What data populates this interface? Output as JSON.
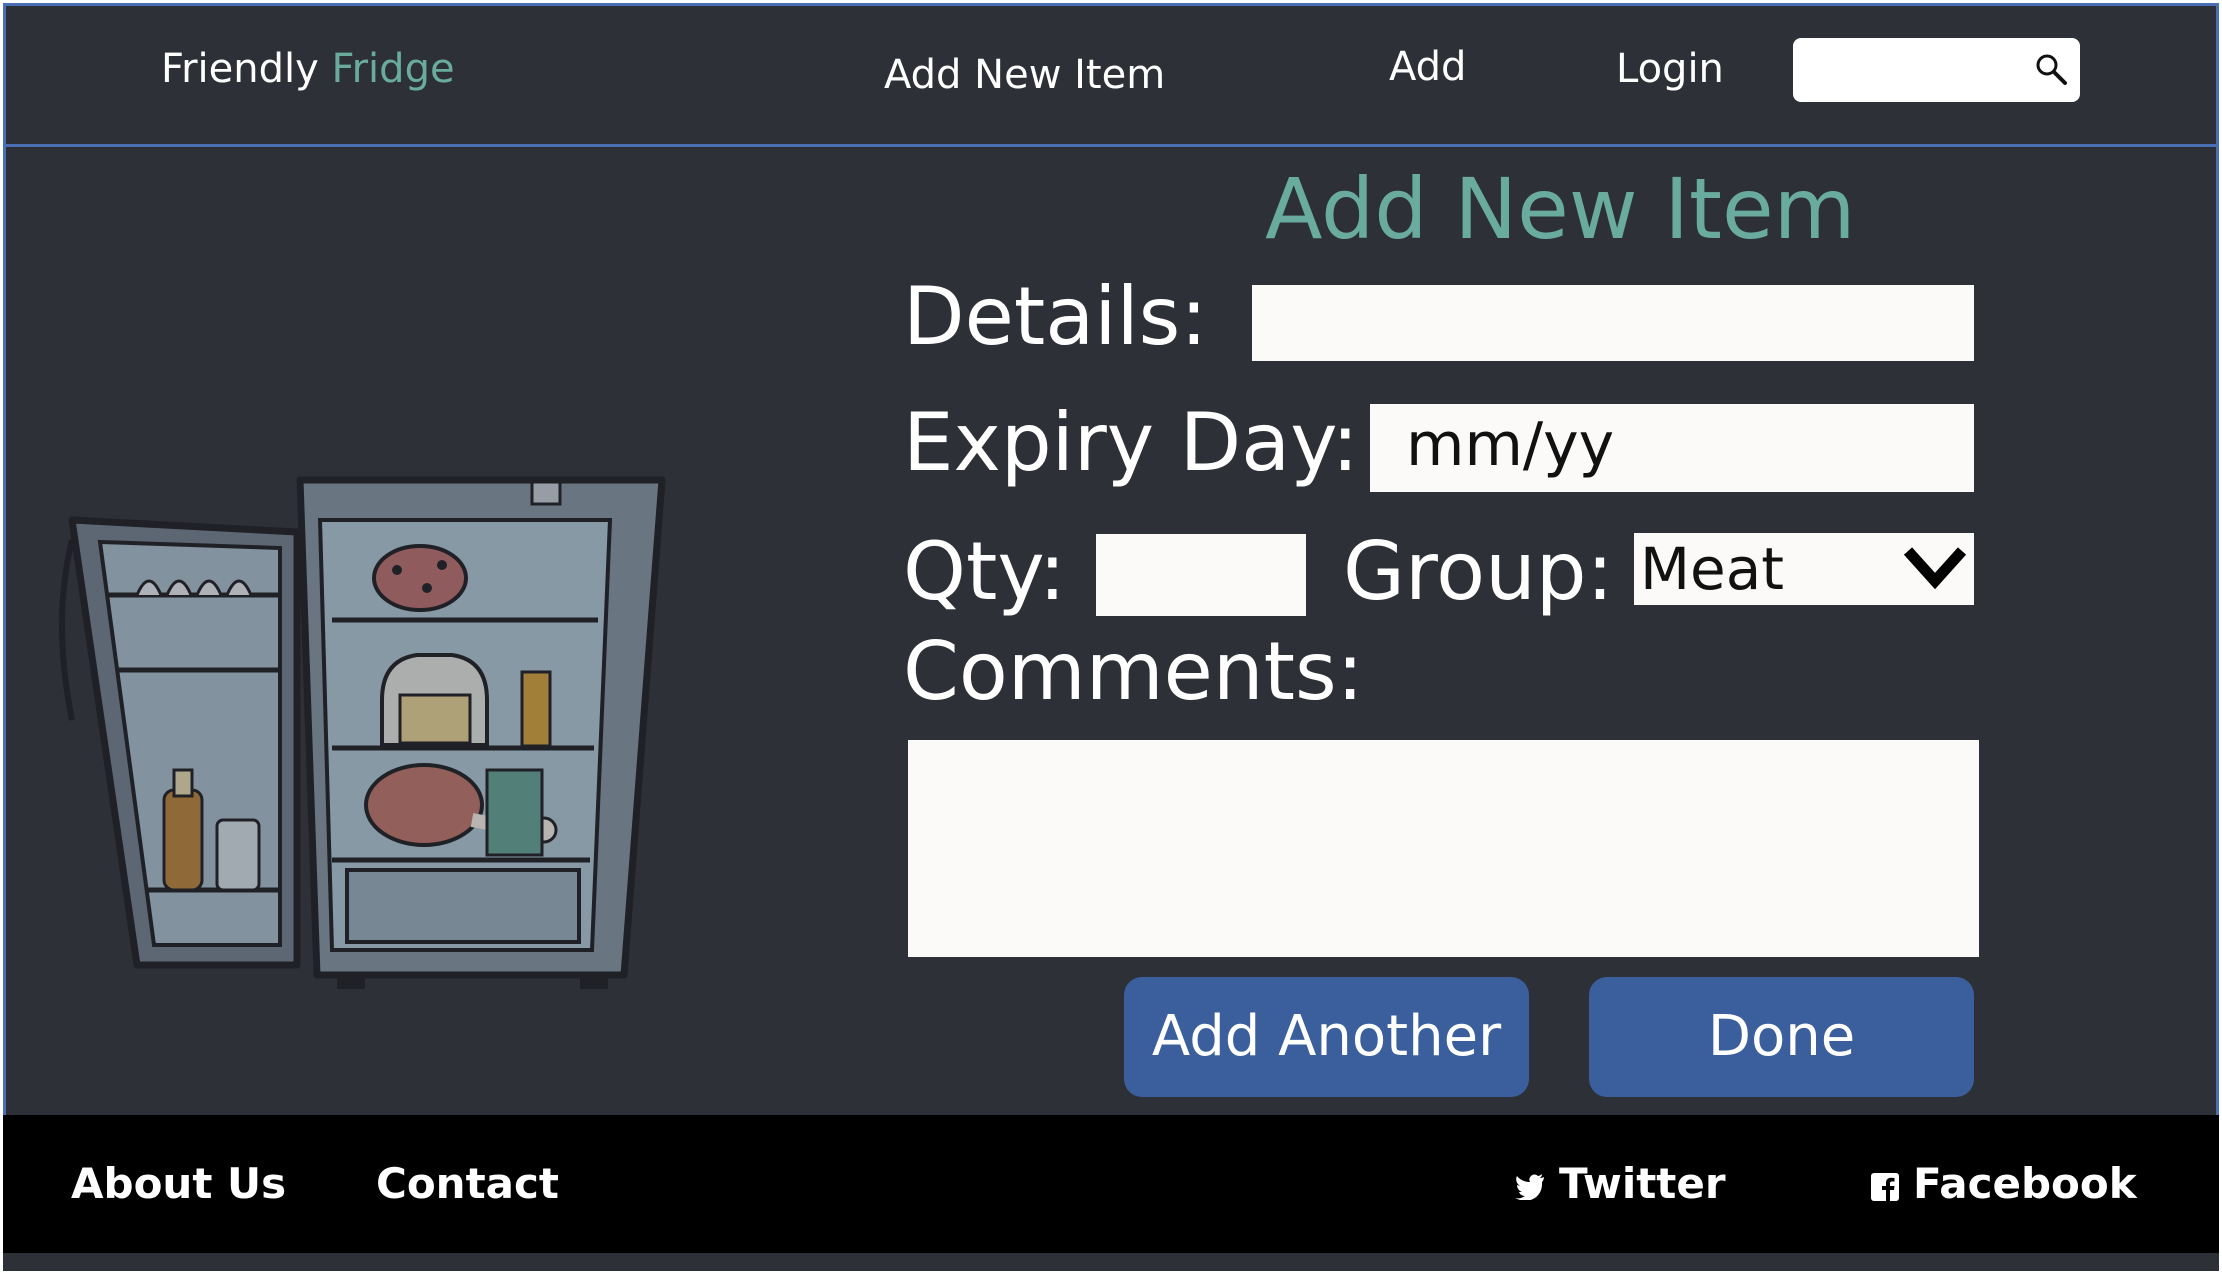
{
  "header": {
    "brand_part1": "Friendly",
    "brand_part2": "Fridge",
    "nav": [
      "Add New Item",
      "Add",
      "Login"
    ],
    "search_placeholder": ""
  },
  "form": {
    "title": "Add New Item",
    "details_label": "Details:",
    "details_value": "",
    "expiry_label": "Expiry Day:",
    "expiry_placeholder": "mm/yy",
    "qty_label": "Qty:",
    "qty_value": "",
    "group_label": "Group:",
    "group_selected": "Meat",
    "comments_label": "Comments:",
    "comments_value": "",
    "add_another_label": "Add Another",
    "done_label": "Done"
  },
  "footer": {
    "about": "About Us",
    "contact": "Contact",
    "twitter": "Twitter",
    "facebook": "Facebook"
  },
  "colors": {
    "background": "#2e3038",
    "accent": "#6aaba0",
    "button": "#3a5f9c",
    "border": "#4a6fb5"
  },
  "icons": [
    "search-icon",
    "chevron-down-icon",
    "twitter-icon",
    "facebook-icon",
    "fridge-illustration"
  ]
}
